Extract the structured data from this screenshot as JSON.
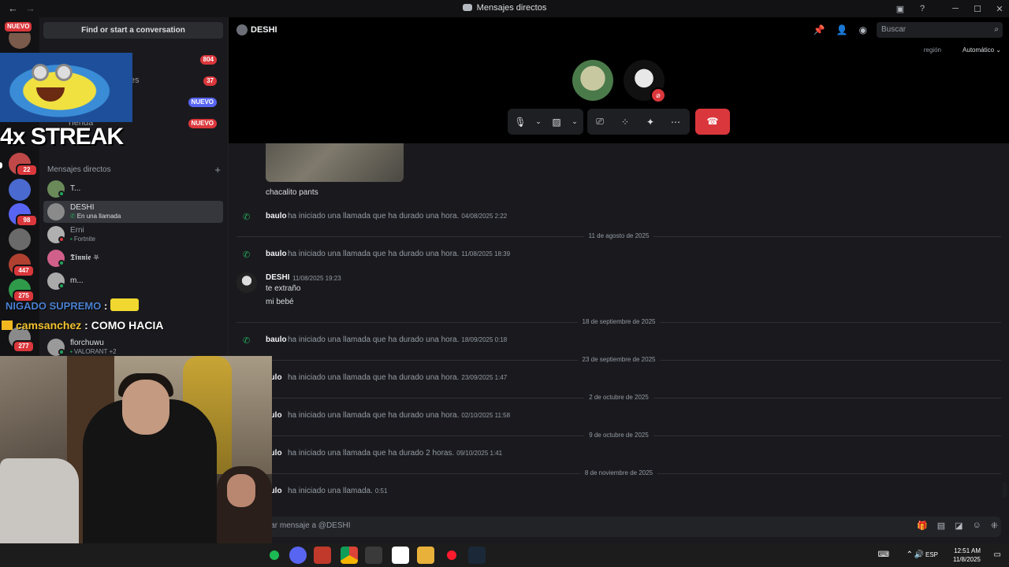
{
  "window": {
    "title": "Mensajes directos"
  },
  "servers": [
    {
      "badge": "NUEVO"
    },
    {
      "badge": "22"
    },
    {
      "badge": ""
    },
    {
      "badge": "98"
    },
    {
      "badge": ""
    },
    {
      "badge": "447"
    },
    {
      "badge": "275"
    },
    {
      "badge": "277"
    }
  ],
  "sidebar": {
    "search_label": "Find or start a conversation",
    "nav": [
      {
        "label": "",
        "badge": "804",
        "badge_color": "#da373c"
      },
      {
        "label": "sajes",
        "badge": "37",
        "badge_color": "#da373c"
      },
      {
        "label": "",
        "badge": "NUEVO",
        "badge_color": "#5865f2"
      },
      {
        "label": "Tienda",
        "badge": "NUEVO",
        "badge_color": "#da373c"
      }
    ],
    "dm_header": "Mensajes directos",
    "dms": [
      {
        "name": "T...",
        "sub": "",
        "status": "online"
      },
      {
        "name": "DESHI",
        "sub": "En una llamada",
        "status": "",
        "active": true
      },
      {
        "name": "Erni",
        "sub": "Fortnite",
        "status": "dnd"
      },
      {
        "name": "𝕿𝖎𝖓𝖓𝖎𝖊 ⛧",
        "sub": "",
        "status": "online"
      },
      {
        "name": "m...",
        "sub": "",
        "status": "online"
      },
      {
        "name": "florchuwu",
        "sub": "VALORANT +2",
        "status": "online"
      }
    ]
  },
  "header": {
    "name": "DESHI",
    "search_placeholder": "Buscar"
  },
  "call": {
    "region_label": "región",
    "region_value": "Automático",
    "avatar_colors": [
      "#5a7a3a",
      "#e8e8e8"
    ]
  },
  "chat": {
    "attachment_caption": "chacalito pants",
    "items": [
      {
        "kind": "call",
        "who": "baulo",
        "text": "ha iniciado una llamada que ha durado una hora.",
        "ts": "04/08/2025 2:22"
      },
      {
        "kind": "date",
        "label": "11 de agosto de 2025"
      },
      {
        "kind": "call",
        "who": "baulo",
        "text": "ha iniciado una llamada que ha durado una hora.",
        "ts": "11/08/2025 18:39"
      },
      {
        "kind": "date",
        "label": "18 de septiembre de 2025"
      },
      {
        "kind": "call",
        "who": "baulo",
        "text": "ha iniciado una llamada que ha durado una hora.",
        "ts": "18/09/2025 0:18"
      },
      {
        "kind": "date",
        "label": "23 de septiembre de 2025"
      },
      {
        "kind": "call",
        "who": "aulo",
        "text": "ha iniciado una llamada que ha durado una hora.",
        "ts": "23/09/2025 1:47"
      },
      {
        "kind": "date",
        "label": "2 de octubre de 2025"
      },
      {
        "kind": "call",
        "who": "aulo",
        "text": "ha iniciado una llamada que ha durado una hora.",
        "ts": "02/10/2025 11:58"
      },
      {
        "kind": "date",
        "label": "9 de octubre de 2025"
      },
      {
        "kind": "call",
        "who": "aulo",
        "text": "ha iniciado una llamada que ha durado 2 horas.",
        "ts": "09/10/2025 1:41"
      },
      {
        "kind": "date",
        "label": "8 de noviembre de 2025"
      },
      {
        "kind": "call",
        "who": "aulo",
        "text": "ha iniciado una llamada.",
        "ts": "0:51"
      }
    ],
    "message": {
      "author": "DESHI",
      "ts": "11/08/2025 19:23",
      "lines": [
        "te extraño",
        "mi bebé"
      ]
    }
  },
  "composer": {
    "placeholder": "viar mensaje a @DESHI"
  },
  "stream_overlay": {
    "streak": "4x STREAK",
    "chat1_user": "NIGADO SUPREMO",
    "chat1_text": " : ",
    "chat2_user": "camsanchez",
    "chat2_text": " : COMO HACIA"
  },
  "taskbar": {
    "lang": "ESP",
    "time": "12:51 AM",
    "date": "11/8/2025"
  },
  "colors": {
    "green": "#23a55a",
    "red": "#da373c",
    "blurple": "#5865f2"
  }
}
